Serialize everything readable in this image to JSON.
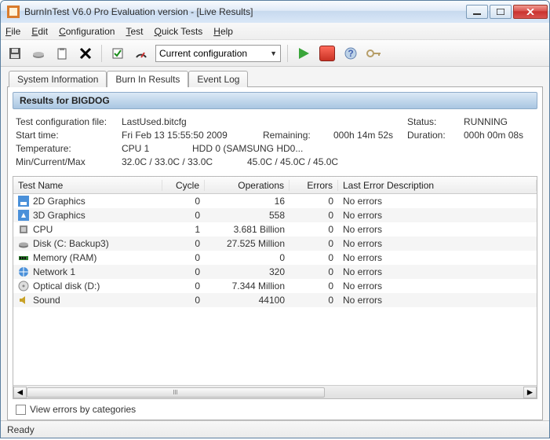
{
  "window": {
    "title": "BurnInTest V6.0 Pro Evaluation version - [Live Results]"
  },
  "menu": {
    "file": "File",
    "edit": "Edit",
    "configuration": "Configuration",
    "test": "Test",
    "quicktests": "Quick Tests",
    "help": "Help"
  },
  "toolbar": {
    "config_label": "Current configuration"
  },
  "tabs": {
    "sysinfo": "System Information",
    "burnin": "Burn In Results",
    "eventlog": "Event Log"
  },
  "header": {
    "results_for": "Results for BIGDOG"
  },
  "info": {
    "test_config_label": "Test configuration file:",
    "test_config_value": "LastUsed.bitcfg",
    "start_label": "Start time:",
    "start_value": "Fri Feb 13 15:55:50 2009",
    "remaining_label": "Remaining:",
    "remaining_value": "000h 14m 52s",
    "temp_label": "Temperature:",
    "temp_sub": "Min/Current/Max",
    "cpu1_label": "CPU 1",
    "cpu1_value": "32.0C / 33.0C / 33.0C",
    "hdd_label": "HDD 0 (SAMSUNG HD0...",
    "hdd_value": "45.0C / 45.0C / 45.0C",
    "status_label": "Status:",
    "status_value": "RUNNING",
    "duration_label": "Duration:",
    "duration_value": "000h 00m 08s"
  },
  "columns": {
    "name": "Test Name",
    "cycle": "Cycle",
    "ops": "Operations",
    "errors": "Errors",
    "lasterr": "Last Error Description"
  },
  "rows": [
    {
      "icon": "graphics-2d",
      "name": "2D Graphics",
      "cycle": "0",
      "ops": "16",
      "errors": "0",
      "lasterr": "No errors"
    },
    {
      "icon": "graphics-3d",
      "name": "3D Graphics",
      "cycle": "0",
      "ops": "558",
      "errors": "0",
      "lasterr": "No errors"
    },
    {
      "icon": "cpu",
      "name": "CPU",
      "cycle": "1",
      "ops": "3.681 Billion",
      "errors": "0",
      "lasterr": "No errors"
    },
    {
      "icon": "disk",
      "name": "Disk (C: Backup3)",
      "cycle": "0",
      "ops": "27.525 Million",
      "errors": "0",
      "lasterr": "No errors"
    },
    {
      "icon": "memory",
      "name": "Memory (RAM)",
      "cycle": "0",
      "ops": "0",
      "errors": "0",
      "lasterr": "No errors"
    },
    {
      "icon": "network",
      "name": "Network 1",
      "cycle": "0",
      "ops": "320",
      "errors": "0",
      "lasterr": "No errors"
    },
    {
      "icon": "optical",
      "name": "Optical disk (D:)",
      "cycle": "0",
      "ops": "7.344 Million",
      "errors": "0",
      "lasterr": "No errors"
    },
    {
      "icon": "sound",
      "name": "Sound",
      "cycle": "0",
      "ops": "44100",
      "errors": "0",
      "lasterr": "No errors"
    }
  ],
  "footer": {
    "view_errors_by_cat": "View errors by categories"
  },
  "statusbar": {
    "text": "Ready"
  }
}
